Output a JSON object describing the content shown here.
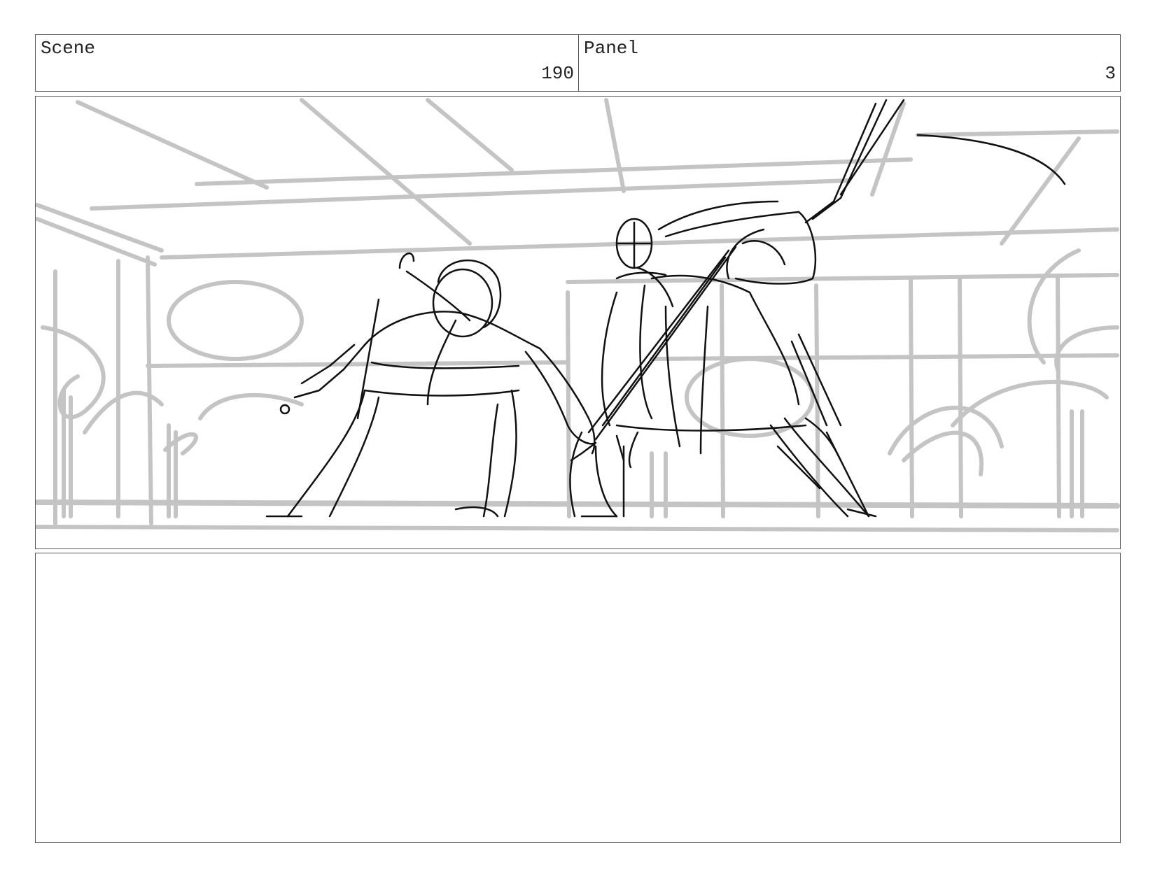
{
  "header": {
    "scene_label": "Scene",
    "scene_number": "190",
    "panel_label": "Panel",
    "panel_number": "3"
  },
  "colors": {
    "border": "#555555",
    "background_sketch": "#c4c4c4",
    "figure_sketch": "#111111"
  }
}
